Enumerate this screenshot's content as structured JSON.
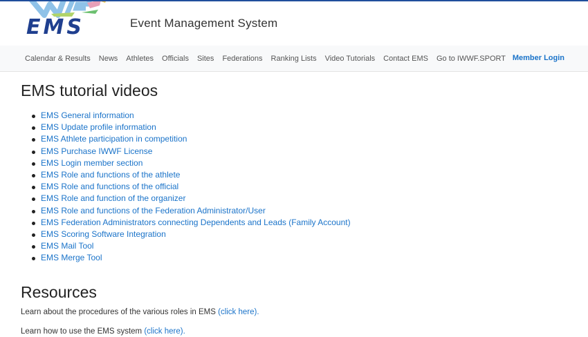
{
  "header": {
    "logo_text": "EMS",
    "site_title": "Event Management System"
  },
  "nav": {
    "items": [
      "Calendar & Results",
      "News",
      "Athletes",
      "Officials",
      "Sites",
      "Federations",
      "Ranking Lists",
      "Video Tutorials",
      "Contact EMS",
      "Go to IWWF.SPORT"
    ],
    "member_login": "Member Login"
  },
  "tutorials": {
    "heading": "EMS tutorial videos",
    "items": [
      "EMS General information",
      "EMS Update profile information",
      "EMS Athlete participation in competition",
      "EMS Purchase IWWF License",
      "EMS Login member section",
      "EMS Role and functions of the athlete",
      "EMS Role and functions of the official",
      "EMS Role and function of the organizer",
      "EMS Role and functions of the Federation Administrator/User",
      "EMS Federation Administrators connecting Dependents and Leads (Family Account)",
      "EMS Scoring Software Integration",
      "EMS Mail Tool",
      "EMS Merge Tool"
    ]
  },
  "resources": {
    "heading": "Resources",
    "lines": [
      {
        "text": "Learn about the procedures of the various roles in EMS ",
        "link": "(click here)."
      },
      {
        "text": "Learn how to use the EMS system ",
        "link": "(click here)."
      }
    ]
  },
  "colors": {
    "link": "#1a73c9",
    "topline": "#1f4e9c",
    "navbar_bg": "#f8f9fa"
  }
}
